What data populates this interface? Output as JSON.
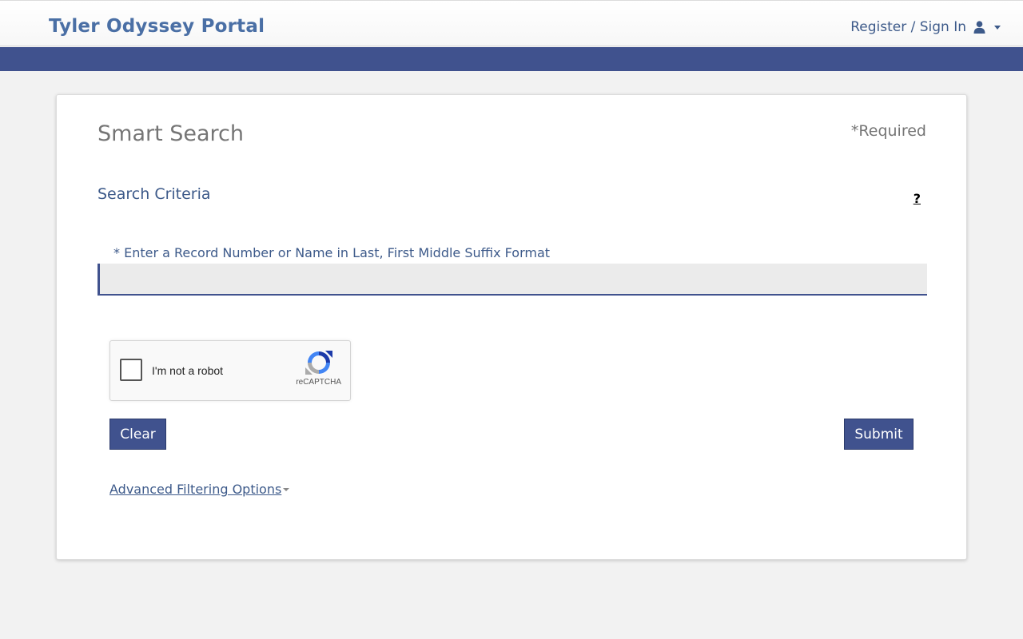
{
  "header": {
    "brand": "Tyler Odyssey Portal",
    "signin_label": "Register / Sign In",
    "signin_icon": "user-icon",
    "colors": {
      "brand": "#4a6fa5",
      "band": "#40528e"
    }
  },
  "search": {
    "title": "Smart Search",
    "required_note": "*Required",
    "criteria_heading": "Search Criteria",
    "help_glyph": "?",
    "field_label": "* Enter a Record Number or Name in Last, First Middle Suffix Format",
    "field_value": "",
    "captcha": {
      "label": "I'm not a robot",
      "brand": "reCAPTCHA",
      "checked": false
    },
    "clear_label": "Clear",
    "submit_label": "Submit",
    "advanced_label": "Advanced Filtering Options"
  }
}
